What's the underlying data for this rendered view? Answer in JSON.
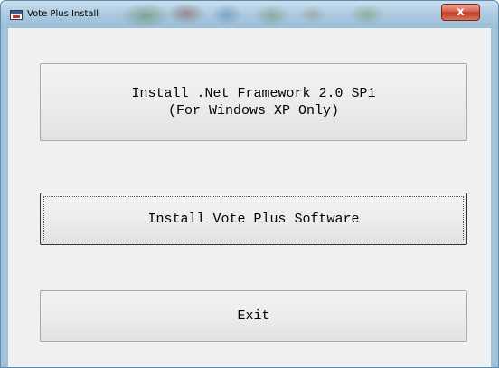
{
  "window": {
    "title": "Vote Plus Install",
    "close_label": "x"
  },
  "buttons": {
    "net_framework": {
      "line1": "Install .Net Framework 2.0 SP1",
      "line2": "(For Windows XP Only)"
    },
    "install_software": "Install Vote Plus Software",
    "exit": "Exit"
  },
  "icons": {
    "app": "app-icon",
    "close": "close-icon"
  },
  "colors": {
    "titlebar": "#a9c8df",
    "client_background": "#f0f0f0",
    "close_button": "#c33c24"
  }
}
